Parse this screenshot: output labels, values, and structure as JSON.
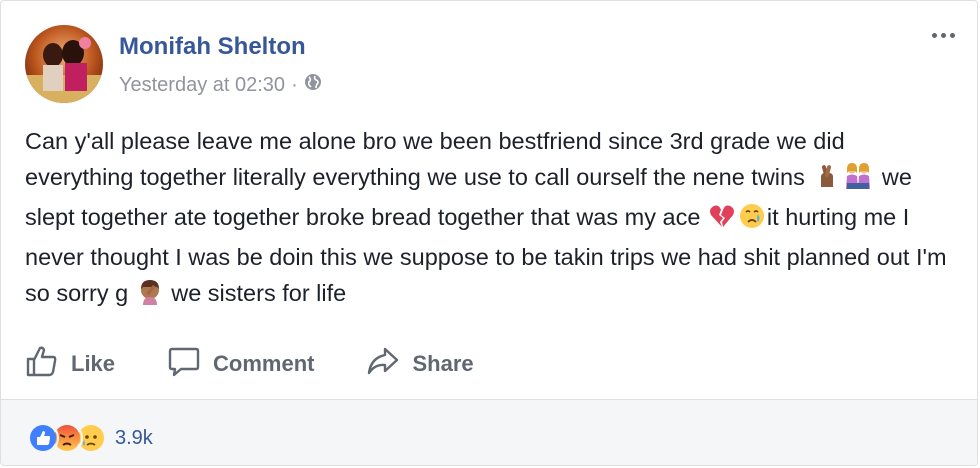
{
  "post": {
    "author": "Monifah Shelton",
    "timestamp": "Yesterday at 02:30",
    "separator": "·",
    "privacy_icon": "globe-icon",
    "text_segments": [
      "Can y'all please leave me alone bro we been bestfriend since 3rd grade we did everything together literally everything we use to call ourself the nene twins ",
      " we slept together ate together broke bread together that was my ace ",
      "it hurting me I never thought I was be doin this we suppose to be takin trips we had shit planned out I'm so sorry g ",
      " we sisters for life"
    ],
    "emojis": [
      "crossed-fingers-emoji",
      "two-women-emoji",
      "broken-heart-emoji",
      "crying-face-emoji",
      "facepalm-emoji"
    ]
  },
  "actions": {
    "like": "Like",
    "comment": "Comment",
    "share": "Share"
  },
  "reactions": {
    "types": [
      "like",
      "angry",
      "sad"
    ],
    "count": "3.9k"
  },
  "colors": {
    "author": "#365899",
    "meta": "#90949c",
    "action": "#606770",
    "like_blue": "#4080ff",
    "footer_bg": "#f5f6f7"
  }
}
